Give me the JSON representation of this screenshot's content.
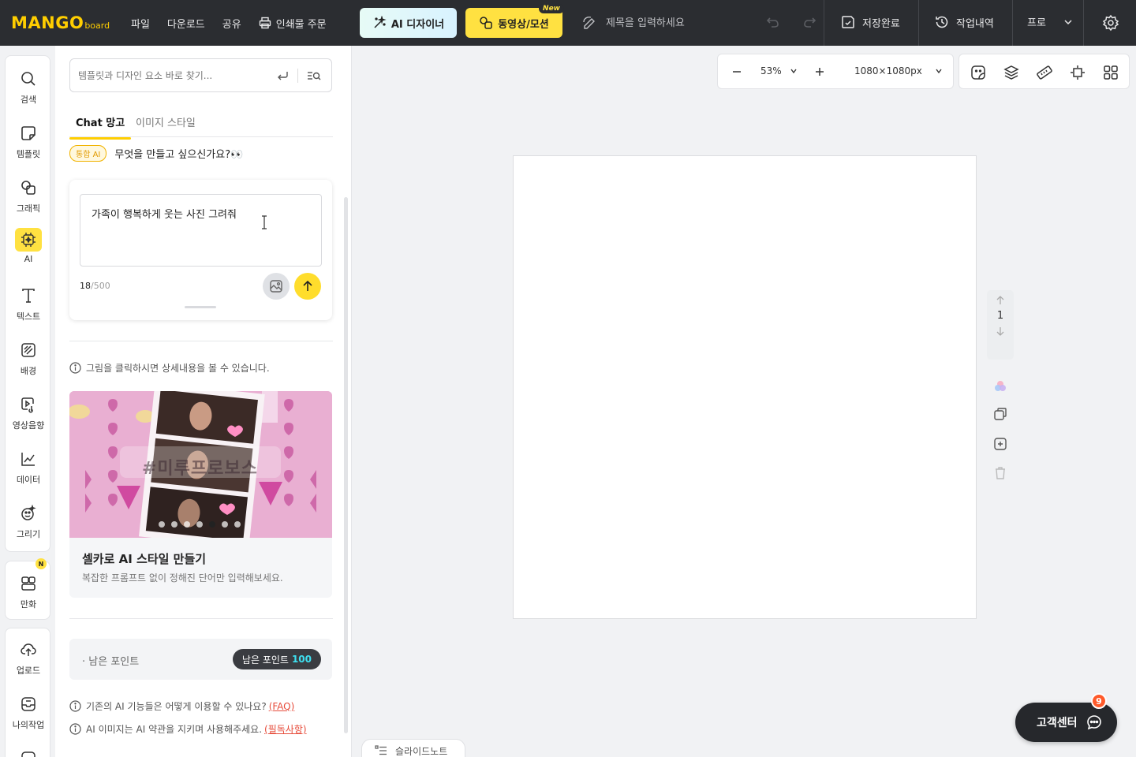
{
  "topbar": {
    "logo_main": "MANGO",
    "logo_sub": "board",
    "menu": [
      "파일",
      "다운로드",
      "공유",
      "인쇄물 주문"
    ],
    "ai_designer": "AI 디자이너",
    "video_motion": "동영상/모션",
    "new_badge": "New",
    "title_placeholder": "제목을 입력하세요",
    "save_status": "저장완료",
    "history": "작업내역",
    "plan": "프로"
  },
  "rail": {
    "main": [
      {
        "label": "검색",
        "icon": "search-icon"
      },
      {
        "label": "템플릿",
        "icon": "template-icon"
      },
      {
        "label": "그래픽",
        "icon": "graphic-icon"
      },
      {
        "label": "AI",
        "icon": "ai-chip-icon"
      },
      {
        "label": "텍스트",
        "icon": "text-icon"
      },
      {
        "label": "배경",
        "icon": "background-icon"
      },
      {
        "label": "영상음향",
        "icon": "media-icon"
      },
      {
        "label": "데이터",
        "icon": "chart-icon"
      },
      {
        "label": "그리기",
        "icon": "draw-icon"
      }
    ],
    "comic": {
      "label": "만화",
      "badge": "N"
    },
    "bottom": [
      {
        "label": "업로드",
        "icon": "upload-icon"
      },
      {
        "label": "나의작업",
        "icon": "my-work-icon"
      }
    ]
  },
  "panel": {
    "search_placeholder": "템플릿과 디자인 요소 바로 찾기...",
    "tabs": [
      "Chat 망고",
      "이미지 스타일"
    ],
    "ai_chip": "통합 AI",
    "ai_question": "무엇을 만들고 싶으신가요?👀",
    "prompt_text": "가족이 행복하게 웃는 사진 그려줘",
    "counter_current": "18",
    "counter_max": "/500",
    "info_click": "그림을 클릭하시면 상세내용을 볼 수 있습니다.",
    "feature": {
      "overlay": "#미루프로보스",
      "title": "셀카로 AI 스타일 만들기",
      "desc": "복잡한 프롬프트 없이 정해진 단어만 입력해보세요.",
      "dots": 7,
      "active_dot": 5
    },
    "points_label": "· 남은 포인트",
    "points_pill_label": "남은 포인트",
    "points_value": "100",
    "faq_text": "기존의 AI 기능들은 어떻게 이용할 수 있나요?",
    "faq_link": "(FAQ)",
    "terms_text": "AI 이미지는 AI 약관을 지키며 사용해주세요.",
    "terms_link": "(필독사항)"
  },
  "canvas": {
    "zoom": "53%",
    "size": "1080×1080px",
    "page_number": "1",
    "slide_note": "슬라이드노트"
  },
  "support": {
    "label": "고객센터",
    "badge": "9"
  },
  "colors": {
    "accent_yellow": "#ffe141",
    "topbar": "#2b2d31",
    "link_red": "#e74d3c"
  }
}
